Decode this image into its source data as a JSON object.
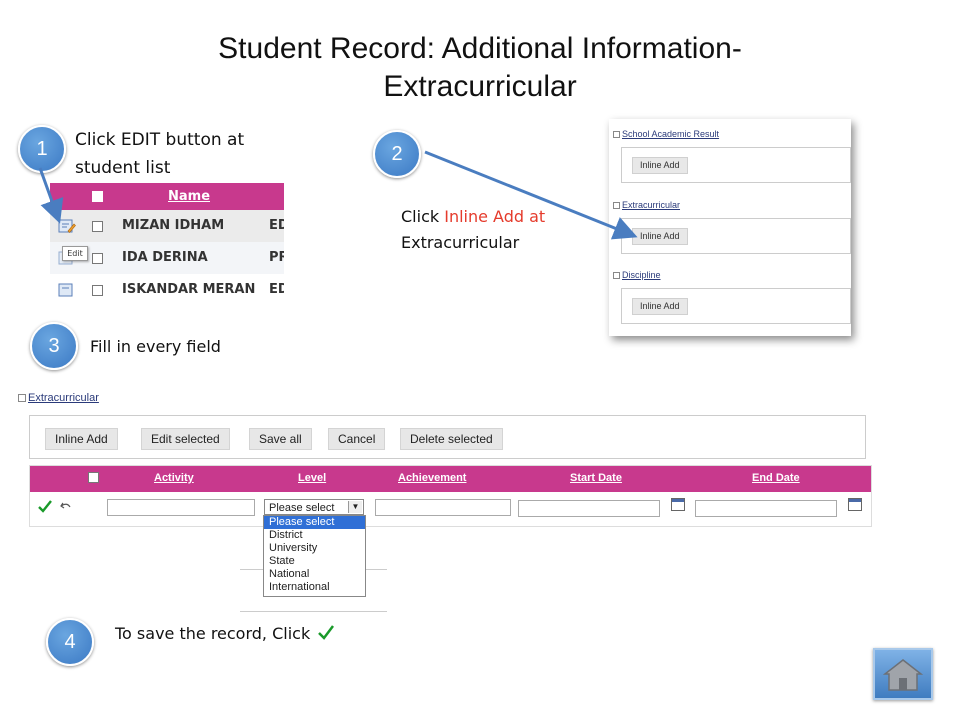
{
  "title_line1": "Student Record: Additional Information-",
  "title_line2": "Extracurricular",
  "steps": {
    "s1": {
      "num": "1",
      "text_line1": "Click EDIT button at",
      "text_line2": "student list"
    },
    "s2": {
      "num": "2",
      "text_pre": "Click ",
      "text_red": "Inline Add at",
      "text_line2": "Extracurricular"
    },
    "s3": {
      "num": "3",
      "text": "Fill in every field"
    },
    "s4": {
      "num": "4",
      "text": "To save the record, Click"
    }
  },
  "student_list": {
    "header": "Name",
    "rows": [
      {
        "name": "MIZAN IDHAM",
        "trail": "ED"
      },
      {
        "name": "IDA DERINA",
        "trail": "PR"
      },
      {
        "name": "ISKANDAR MERAN",
        "trail": "ED"
      }
    ],
    "tooltip": "Edit"
  },
  "sections": [
    {
      "title": "School Academic Result",
      "button": "Inline Add"
    },
    {
      "title": "Extracurricular",
      "button": "Inline Add"
    },
    {
      "title": "Discipline",
      "button": "Inline Add"
    }
  ],
  "form": {
    "section_title": "Extracurricular",
    "toolbar": [
      "Inline Add",
      "Edit selected",
      "Save all",
      "Cancel",
      "Delete selected"
    ],
    "columns": [
      "Activity",
      "Level",
      "Achievement",
      "Start Date",
      "End Date"
    ],
    "level_selected": "Please select",
    "level_options": [
      "Please select",
      "District",
      "University",
      "State",
      "National",
      "International"
    ]
  },
  "colors": {
    "accent": "#c8398d",
    "step": "#3b79c4",
    "highlight_text": "#e53b2c",
    "save_check": "#1a9a2a"
  },
  "icons": {
    "save": "check-icon",
    "undo": "undo-icon",
    "home": "home-icon",
    "calendar": "calendar-icon"
  }
}
